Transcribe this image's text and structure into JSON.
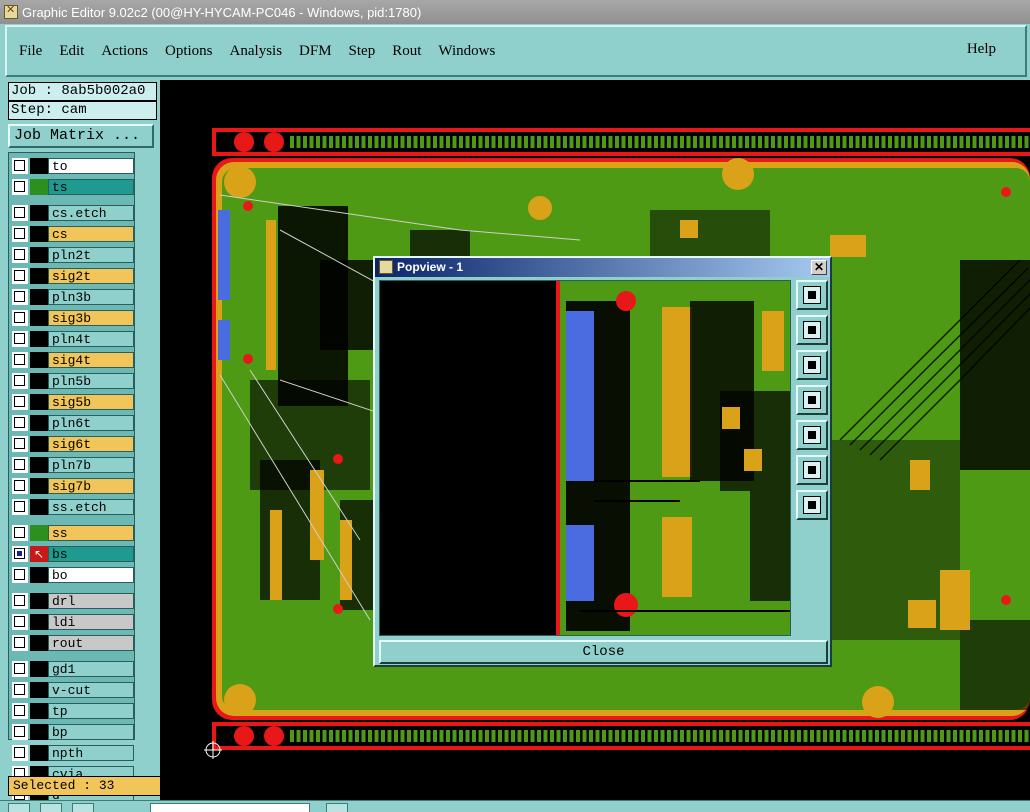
{
  "window": {
    "title": "Graphic Editor 9.02c2 (00@HY-HYCAM-PC046 - Windows, pid:1780)"
  },
  "menu": {
    "items": [
      "File",
      "Edit",
      "Actions",
      "Options",
      "Analysis",
      "DFM",
      "Step",
      "Rout",
      "Windows"
    ],
    "help": "Help"
  },
  "job": {
    "job_label": "Job : 8ab5b002a0",
    "step_label": "Step: cam",
    "matrix_button": "Job Matrix ..."
  },
  "layers": [
    {
      "name": "to",
      "color": "#ffffff"
    },
    {
      "name": "ts",
      "color": "#1f9a90"
    },
    {
      "name": "cs.etch",
      "color": "#8fd0cc"
    },
    {
      "name": "cs",
      "color": "#f2c55a"
    },
    {
      "name": "pln2t",
      "color": "#8fd0cc"
    },
    {
      "name": "sig2t",
      "color": "#f2c55a"
    },
    {
      "name": "pln3b",
      "color": "#8fd0cc"
    },
    {
      "name": "sig3b",
      "color": "#f2c55a"
    },
    {
      "name": "pln4t",
      "color": "#8fd0cc"
    },
    {
      "name": "sig4t",
      "color": "#f2c55a"
    },
    {
      "name": "pln5b",
      "color": "#8fd0cc"
    },
    {
      "name": "sig5b",
      "color": "#f2c55a"
    },
    {
      "name": "pln6t",
      "color": "#8fd0cc"
    },
    {
      "name": "sig6t",
      "color": "#f2c55a"
    },
    {
      "name": "pln7b",
      "color": "#8fd0cc"
    },
    {
      "name": "sig7b",
      "color": "#f2c55a"
    },
    {
      "name": "ss.etch",
      "color": "#8fd0cc"
    },
    {
      "name": "ss",
      "color": "#f2c55a"
    },
    {
      "name": "bs",
      "color": "#1f9a90"
    },
    {
      "name": "bo",
      "color": "#ffffff"
    },
    {
      "name": "drl",
      "color": "#c8c8c8"
    },
    {
      "name": "ldi",
      "color": "#c8c8c8"
    },
    {
      "name": "rout",
      "color": "#c8c8c8"
    },
    {
      "name": "gd1",
      "color": "#8fd0cc"
    },
    {
      "name": "v-cut",
      "color": "#8fd0cc"
    },
    {
      "name": "tp",
      "color": "#8fd0cc"
    },
    {
      "name": "bp",
      "color": "#8fd0cc"
    },
    {
      "name": "npth",
      "color": "#8fd0cc"
    },
    {
      "name": "cvia",
      "color": "#8fd0cc"
    },
    {
      "name": "d",
      "color": "#8fd0cc"
    }
  ],
  "status": {
    "selected": "Selected : 33"
  },
  "popview": {
    "title": "Popview - 1",
    "close_label": "Close"
  },
  "colors": {
    "board_green": "#4f9a14",
    "copper": "#d9a218",
    "outline_red": "#e81818",
    "pad_blue": "#4a6ce0"
  }
}
